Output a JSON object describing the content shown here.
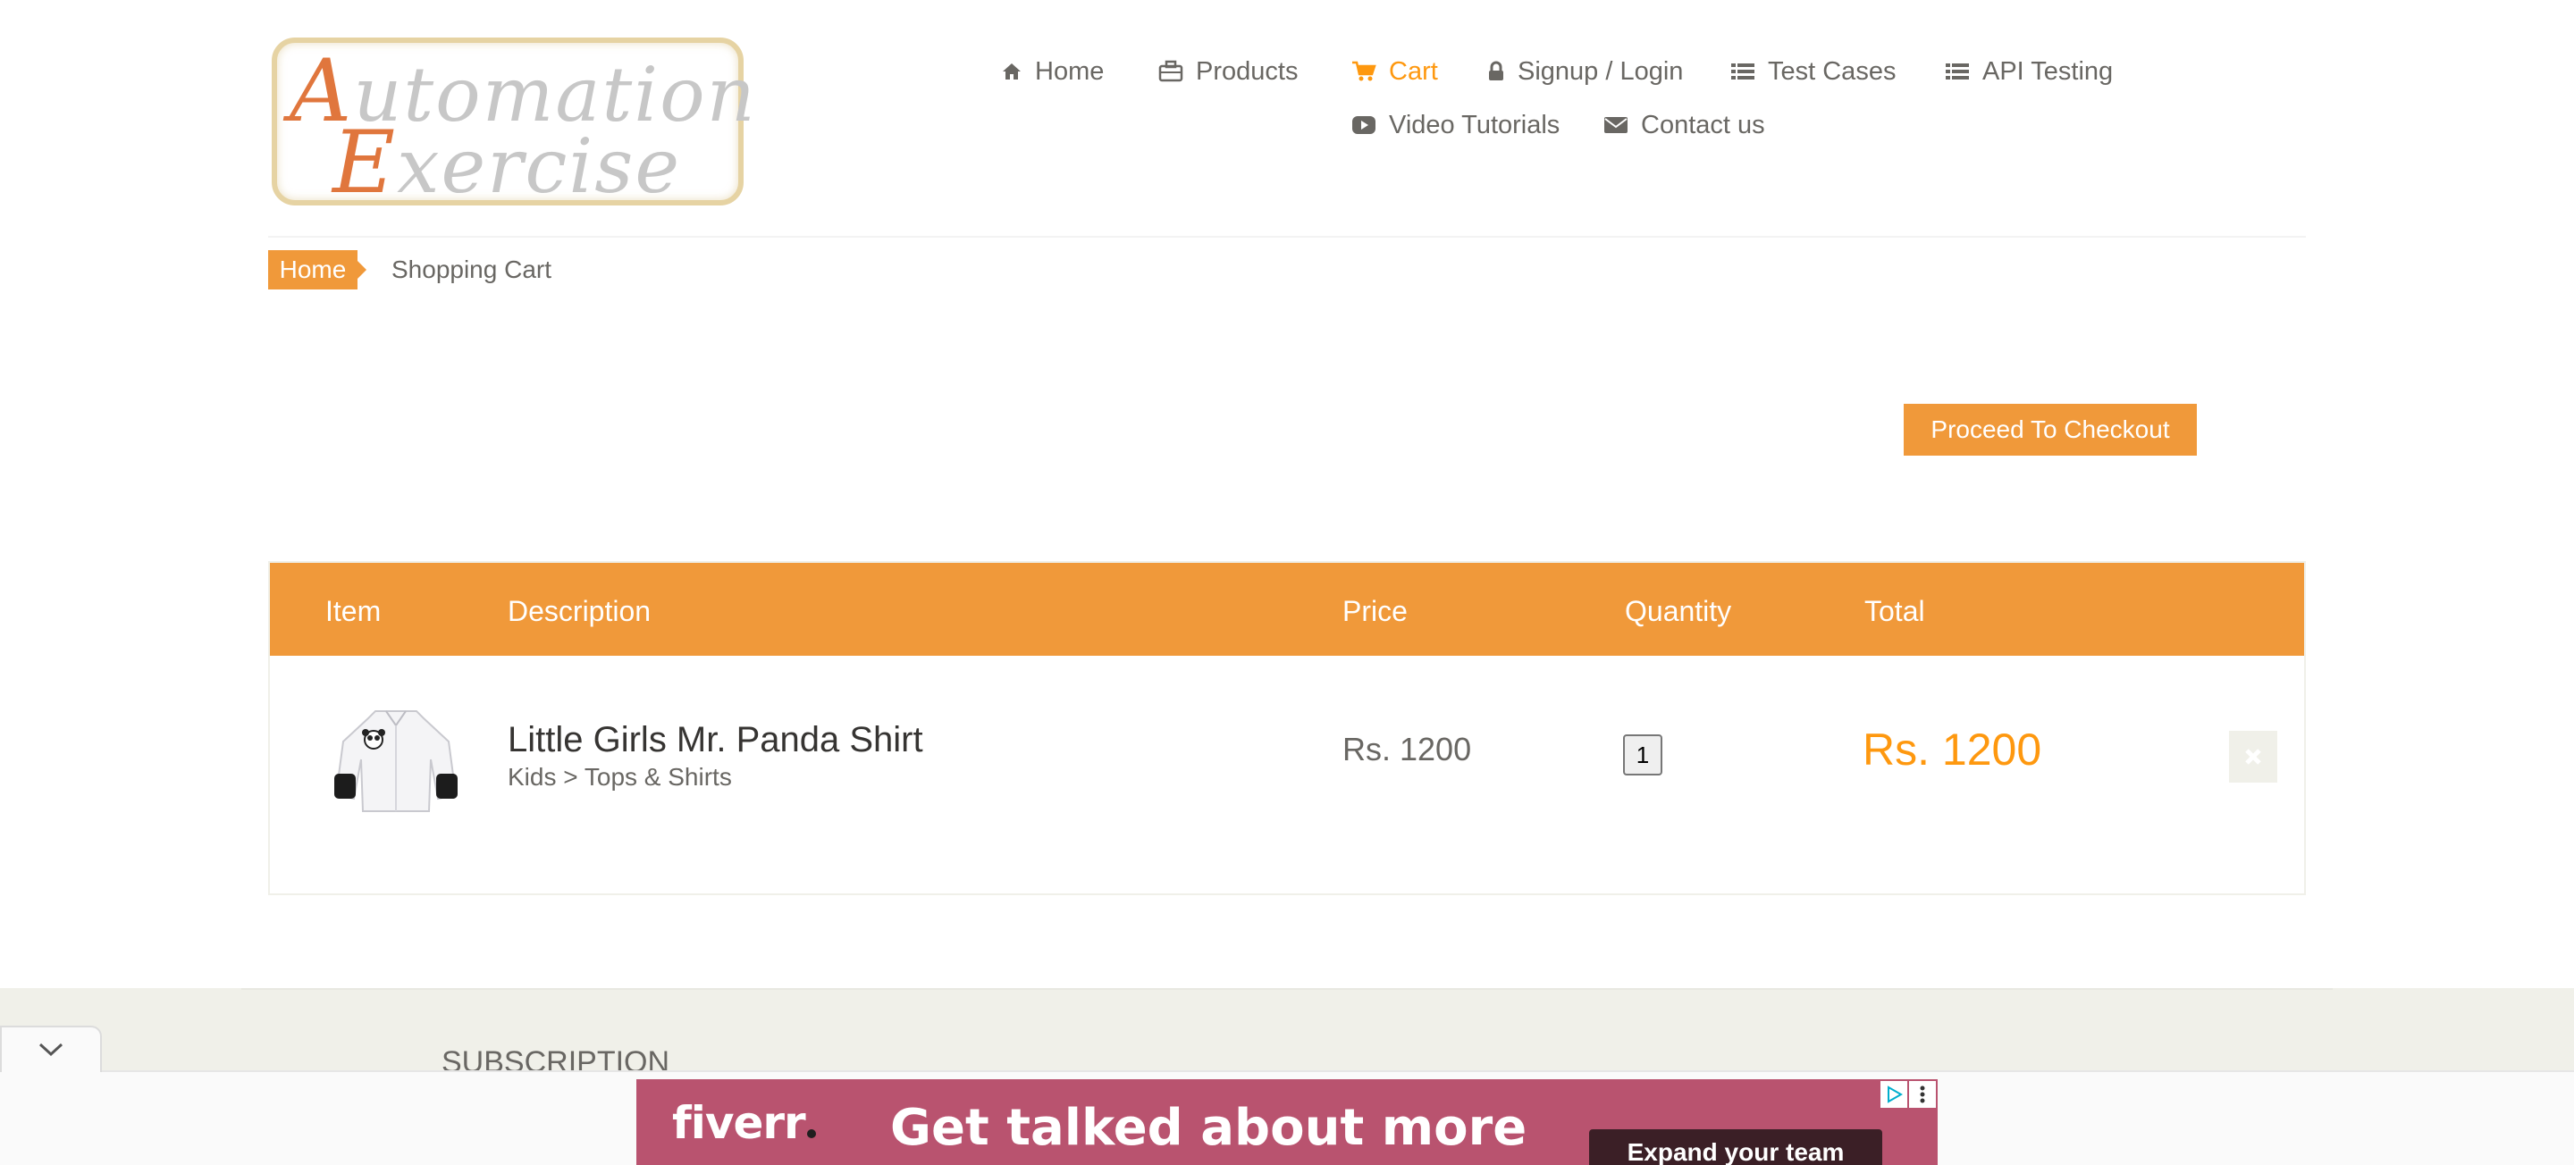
{
  "logo": {
    "line1": "Automation",
    "line2": "Exercise"
  },
  "nav": {
    "items": [
      {
        "label": "Home",
        "icon": "home-icon"
      },
      {
        "label": "Products",
        "icon": "briefcase-icon"
      },
      {
        "label": "Cart",
        "icon": "cart-icon",
        "active": true
      },
      {
        "label": "Signup / Login",
        "icon": "lock-icon"
      },
      {
        "label": "Test Cases",
        "icon": "list-icon"
      },
      {
        "label": "API Testing",
        "icon": "list-icon"
      },
      {
        "label": "Video Tutorials",
        "icon": "youtube-play-icon"
      },
      {
        "label": "Contact us",
        "icon": "envelope-icon"
      }
    ]
  },
  "breadcrumb": {
    "home": "Home",
    "current": "Shopping Cart"
  },
  "checkout": {
    "label": "Proceed To Checkout"
  },
  "cart": {
    "headers": [
      "Item",
      "Description",
      "Price",
      "Quantity",
      "Total"
    ],
    "rows": [
      {
        "name": "Little Girls Mr. Panda Shirt",
        "category": "Kids > Tops & Shirts",
        "price": "Rs. 1200",
        "quantity": "1",
        "total": "Rs. 1200",
        "delete_icon": "close-icon"
      }
    ]
  },
  "footer": {
    "subscription_title": "SUBSCRIPTION"
  },
  "ad": {
    "brand": "fiverr",
    "headline": "Get talked about more",
    "cta": "Expand your team"
  },
  "colors": {
    "accent": "#fe980f",
    "header_orange": "#f0993a",
    "text": "#696763",
    "ad_bg": "#b9536f"
  }
}
